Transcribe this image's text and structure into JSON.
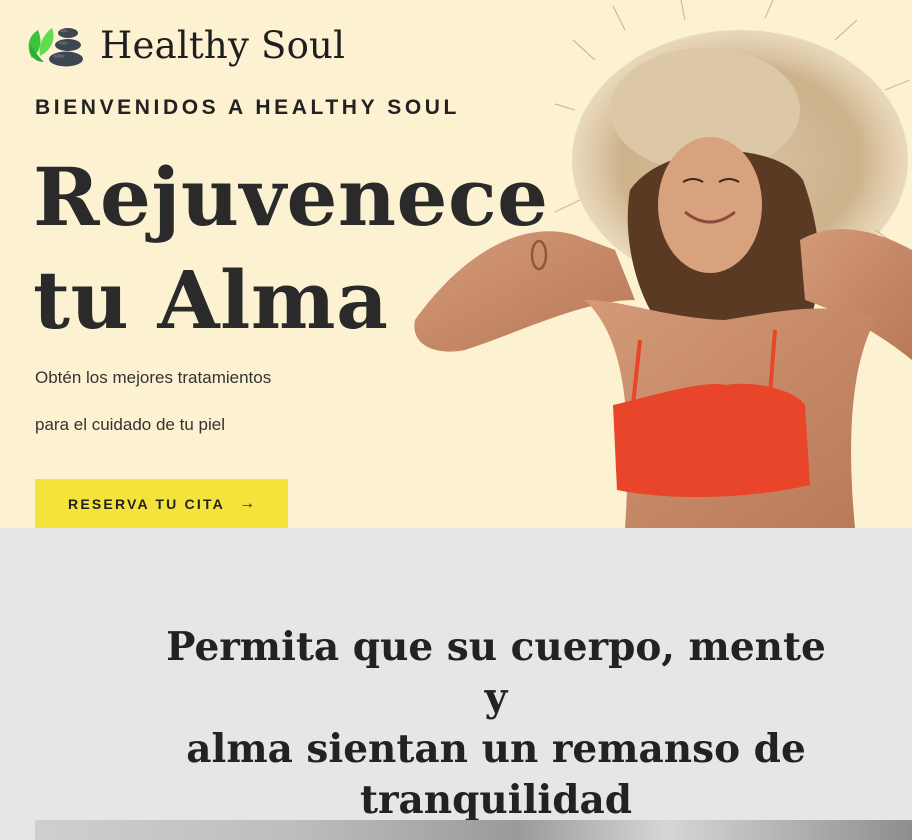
{
  "brand": {
    "name": "Healthy Soul",
    "leaf_color": "#4bd44a",
    "stone_color": "#3e4652"
  },
  "nav": {
    "top_links": [
      "",
      ""
    ]
  },
  "hero": {
    "eyebrow": "BIENVENIDOS A HEALTHY SOUL",
    "headline_line1": "Rejuvenece",
    "headline_line2": "tu Alma",
    "subtitle_line1": "Obtén los mejores tratamientos",
    "subtitle_line2": "para el cuidado de tu piel",
    "cta_label": "RESERVA TU CITA",
    "cta_icon": "arrow-right-icon",
    "cta_color": "#f4e33a",
    "background_color": "#fcf2d1"
  },
  "intro": {
    "line1": "Permita que su cuerpo, mente y",
    "line2": "alma sientan un remanso de",
    "line3": "tranquilidad"
  }
}
